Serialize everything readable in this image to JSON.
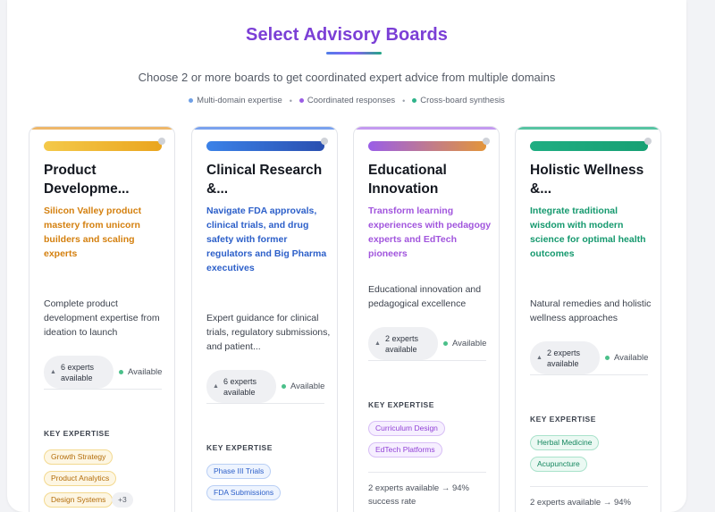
{
  "header": {
    "title": "Select Advisory Boards",
    "subtitle": "Choose 2 or more boards to get coordinated expert advice from multiple domains",
    "features": [
      {
        "label": "Multi-domain expertise",
        "color": "#6fa0e6"
      },
      {
        "label": "Coordinated responses",
        "color": "#9b5de5"
      },
      {
        "label": "Cross-board synthesis",
        "color": "#2fb38a"
      }
    ],
    "separator": "•"
  },
  "cards": [
    {
      "title": "Product Developme...",
      "tagline": "Silicon Valley product mastery from unicorn builders and scaling experts",
      "description": "Complete product development expertise from ideation to launch",
      "experts": "6 experts available",
      "availability": "Available",
      "key_expertise_label": "KEY EXPERTISE",
      "tags": [
        "Growth Strategy",
        "Product Analytics",
        "Design Systems"
      ],
      "more": "+3",
      "accent": "#e8a33c",
      "tagline_color": "#d4800f"
    },
    {
      "title": "Clinical Research &...",
      "tagline": "Navigate FDA approvals, clinical trials, and drug safety with former regulators and Big Pharma executives",
      "description": "Expert guidance for clinical trials, regulatory submissions, and patient...",
      "experts": "6 experts available",
      "availability": "Available",
      "key_expertise_label": "KEY EXPERTISE",
      "tags": [
        "Phase III Trials",
        "FDA Submissions"
      ],
      "accent": "#4a7de0",
      "tagline_color": "#2c5fc9"
    },
    {
      "title": "Educational Innovation",
      "tagline": "Transform learning experiences with pedagogy experts and EdTech pioneers",
      "description": "Educational innovation and pedagogical excellence",
      "experts": "2 experts available",
      "availability": "Available",
      "key_expertise_label": "KEY EXPERTISE",
      "tags": [
        "Curriculum Design",
        "EdTech Platforms"
      ],
      "footer": "2 experts available → 94% success rate",
      "accent": "#a368e8",
      "tagline_color": "#a155dd"
    },
    {
      "title": "Holistic Wellness &...",
      "tagline": "Integrate traditional wisdom with modern science for optimal health outcomes",
      "description": "Natural remedies and holistic wellness approaches",
      "experts": "2 experts available",
      "availability": "Available",
      "key_expertise_label": "KEY EXPERTISE",
      "tags": [
        "Herbal Medicine",
        "Acupuncture"
      ],
      "footer": "2 experts available → 94%",
      "accent": "#25b088",
      "tagline_color": "#15996e"
    }
  ]
}
